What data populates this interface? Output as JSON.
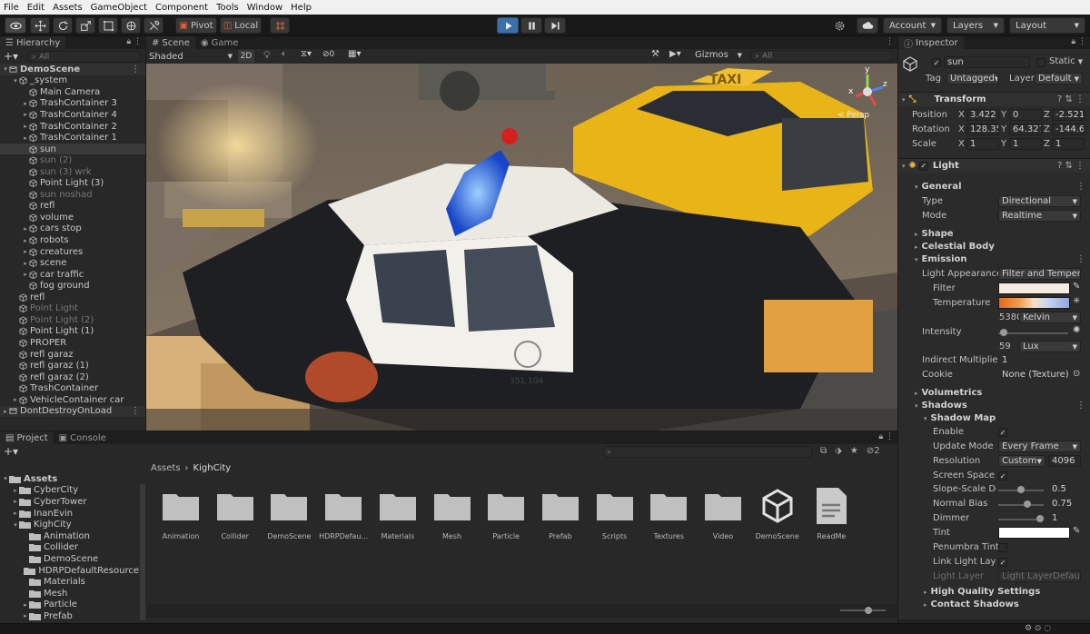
{
  "menu": [
    "File",
    "Edit",
    "Assets",
    "GameObject",
    "Component",
    "Tools",
    "Window",
    "Help"
  ],
  "toolbar": {
    "pivot": "Pivot",
    "local": "Local",
    "account": "Account",
    "layers": "Layers",
    "layout": "Layout"
  },
  "hierarchy": {
    "tab": "Hierarchy",
    "search_placeholder": "All",
    "rows": [
      {
        "label": "DemoScene",
        "depth": 0,
        "arrow": "▾",
        "icon": "scene",
        "dim": false,
        "bold": true
      },
      {
        "label": "_system",
        "depth": 1,
        "arrow": "▾",
        "icon": "cube",
        "dim": false
      },
      {
        "label": "Main Camera",
        "depth": 2,
        "arrow": "",
        "icon": "cube",
        "dim": false
      },
      {
        "label": "TrashContainer 3",
        "depth": 2,
        "arrow": "▸",
        "icon": "cube",
        "dim": false
      },
      {
        "label": "TrashContainer 4",
        "depth": 2,
        "arrow": "▸",
        "icon": "cube",
        "dim": false
      },
      {
        "label": "TrashContainer 2",
        "depth": 2,
        "arrow": "▸",
        "icon": "cube",
        "dim": false
      },
      {
        "label": "TrashContainer 1",
        "depth": 2,
        "arrow": "▸",
        "icon": "cube",
        "dim": false
      },
      {
        "label": "sun",
        "depth": 2,
        "arrow": "",
        "icon": "cube",
        "dim": false,
        "selected": true
      },
      {
        "label": "sun (2)",
        "depth": 2,
        "arrow": "",
        "icon": "cube",
        "dim": true
      },
      {
        "label": "sun (3) wrk",
        "depth": 2,
        "arrow": "",
        "icon": "cube",
        "dim": true
      },
      {
        "label": "Point Light (3)",
        "depth": 2,
        "arrow": "",
        "icon": "cube",
        "dim": false
      },
      {
        "label": "sun noshad",
        "depth": 2,
        "arrow": "",
        "icon": "cube",
        "dim": true
      },
      {
        "label": "refl",
        "depth": 2,
        "arrow": "",
        "icon": "cube",
        "dim": false
      },
      {
        "label": "volume",
        "depth": 2,
        "arrow": "",
        "icon": "cube",
        "dim": false
      },
      {
        "label": "cars stop",
        "depth": 2,
        "arrow": "▸",
        "icon": "cube",
        "dim": false
      },
      {
        "label": "robots",
        "depth": 2,
        "arrow": "▸",
        "icon": "cube",
        "dim": false
      },
      {
        "label": "creatures",
        "depth": 2,
        "arrow": "▸",
        "icon": "cube",
        "dim": false
      },
      {
        "label": "scene",
        "depth": 2,
        "arrow": "▸",
        "icon": "cube",
        "dim": false
      },
      {
        "label": "car traffic",
        "depth": 2,
        "arrow": "▸",
        "icon": "cube",
        "dim": false
      },
      {
        "label": "fog ground",
        "depth": 2,
        "arrow": "",
        "icon": "cube",
        "dim": false
      },
      {
        "label": "refl",
        "depth": 1,
        "arrow": "",
        "icon": "cube",
        "dim": false
      },
      {
        "label": "Point Light",
        "depth": 1,
        "arrow": "",
        "icon": "cube",
        "dim": true
      },
      {
        "label": "Point Light (2)",
        "depth": 1,
        "arrow": "",
        "icon": "cube",
        "dim": true
      },
      {
        "label": "Point Light (1)",
        "depth": 1,
        "arrow": "",
        "icon": "cube",
        "dim": false
      },
      {
        "label": "PROPER",
        "depth": 1,
        "arrow": "",
        "icon": "cube",
        "dim": false
      },
      {
        "label": "refl garaz",
        "depth": 1,
        "arrow": "",
        "icon": "cube",
        "dim": false
      },
      {
        "label": "refl garaz (1)",
        "depth": 1,
        "arrow": "",
        "icon": "cube",
        "dim": false
      },
      {
        "label": "refl garaz (2)",
        "depth": 1,
        "arrow": "",
        "icon": "cube",
        "dim": false
      },
      {
        "label": "TrashContainer",
        "depth": 1,
        "arrow": "",
        "icon": "cube",
        "dim": false
      },
      {
        "label": "VehicleContainer car",
        "depth": 1,
        "arrow": "▸",
        "icon": "cube",
        "dim": false
      },
      {
        "label": "DontDestroyOnLoad",
        "depth": 0,
        "arrow": "▸",
        "icon": "scene",
        "dim": false
      }
    ]
  },
  "scene": {
    "tab_scene": "Scene",
    "tab_game": "Game",
    "shaded": "Shaded",
    "mode_2d": "2D",
    "hidden_count": "0",
    "gizmos": "Gizmos",
    "search_placeholder": "All",
    "persp": "< Persp",
    "axis_y": "y",
    "axis_x": "x",
    "axis_z": "z",
    "taxi_sign": "TAXI",
    "plate": "351.104"
  },
  "project": {
    "tab_project": "Project",
    "tab_console": "Console",
    "badge_count": "2",
    "breadcrumb": [
      "Assets",
      "KighCity"
    ],
    "tree": [
      {
        "label": "Assets",
        "depth": 0,
        "arrow": "▾",
        "bold": true
      },
      {
        "label": "CyberCity",
        "depth": 1,
        "arrow": "▸"
      },
      {
        "label": "CyberTower",
        "depth": 1,
        "arrow": "▸"
      },
      {
        "label": "InanEvin",
        "depth": 1,
        "arrow": "▸"
      },
      {
        "label": "KighCity",
        "depth": 1,
        "arrow": "▾"
      },
      {
        "label": "Animation",
        "depth": 2,
        "arrow": ""
      },
      {
        "label": "Collider",
        "depth": 2,
        "arrow": ""
      },
      {
        "label": "DemoScene",
        "depth": 2,
        "arrow": ""
      },
      {
        "label": "HDRPDefaultResource",
        "depth": 2,
        "arrow": ""
      },
      {
        "label": "Materials",
        "depth": 2,
        "arrow": ""
      },
      {
        "label": "Mesh",
        "depth": 2,
        "arrow": ""
      },
      {
        "label": "Particle",
        "depth": 2,
        "arrow": "▸"
      },
      {
        "label": "Prefab",
        "depth": 2,
        "arrow": "▸"
      }
    ],
    "assets": [
      {
        "label": "Animation",
        "kind": "folder"
      },
      {
        "label": "Collider",
        "kind": "folder"
      },
      {
        "label": "DemoScene",
        "kind": "folder"
      },
      {
        "label": "HDRPDefau...",
        "kind": "folder"
      },
      {
        "label": "Materials",
        "kind": "folder"
      },
      {
        "label": "Mesh",
        "kind": "folder"
      },
      {
        "label": "Particle",
        "kind": "folder"
      },
      {
        "label": "Prefab",
        "kind": "folder"
      },
      {
        "label": "Scripts",
        "kind": "folder"
      },
      {
        "label": "Textures",
        "kind": "folder"
      },
      {
        "label": "Video",
        "kind": "folder"
      },
      {
        "label": "DemoScene",
        "kind": "unity"
      },
      {
        "label": "ReadMe",
        "kind": "doc"
      }
    ]
  },
  "inspector": {
    "tab": "Inspector",
    "object_name": "sun",
    "static": "Static",
    "tag_label": "Tag",
    "tag_value": "Untagged",
    "layer_label": "Layer",
    "layer_value": "Default",
    "transform": {
      "title": "Transform",
      "position_label": "Position",
      "rotation_label": "Rotation",
      "scale_label": "Scale",
      "position": [
        "3.422",
        "0",
        "-2.521"
      ],
      "rotation": [
        "128.35",
        "64.327",
        "-144.6"
      ],
      "scale": [
        "1",
        "1",
        "1"
      ]
    },
    "light": {
      "title": "Light",
      "general": "General",
      "type_label": "Type",
      "type_value": "Directional",
      "mode_label": "Mode",
      "mode_value": "Realtime",
      "shape": "Shape",
      "celestial": "Celestial Body",
      "emission": "Emission",
      "appearance_label": "Light Appearance",
      "appearance_value": "Filter and Temper",
      "filter_label": "Filter",
      "temperature_label": "Temperature",
      "temperature_value": "5380",
      "temperature_unit": "Kelvin",
      "intensity_label": "Intensity",
      "intensity_value": "59",
      "intensity_unit": "Lux",
      "indirect_label": "Indirect Multiplier",
      "indirect_value": "1",
      "cookie_label": "Cookie",
      "cookie_value": "None (Texture)",
      "volumetrics": "Volumetrics",
      "shadows": "Shadows",
      "shadow_map": "Shadow Map",
      "enable_label": "Enable",
      "update_label": "Update Mode",
      "update_value": "Every Frame",
      "resolution_label": "Resolution",
      "resolution_value": "Custom",
      "resolution_num": "4096",
      "screen_space_label": "Screen Space S",
      "slope_label": "Slope-Scale De",
      "slope_value": "0.5",
      "normal_label": "Normal Bias",
      "normal_value": "0.75",
      "dimmer_label": "Dimmer",
      "dimmer_value": "1",
      "tint_label": "Tint",
      "penumbra_label": "Penumbra Tint",
      "link_label": "Link Light Laye",
      "light_layer_label": "Light Layer",
      "light_layer_value": "Light LayerDefau",
      "hq": "High Quality Settings",
      "contact": "Contact Shadows"
    },
    "colors": {
      "filter": "#f6ebe1",
      "tint": "#ffffff"
    }
  },
  "colors": {
    "accent": "#4a86c8",
    "selected_row": "#3a3a3a"
  }
}
